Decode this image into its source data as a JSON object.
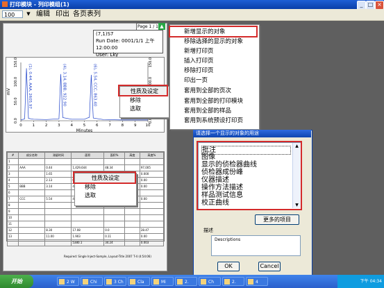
{
  "window": {
    "title": "打印模块 - 列印模组(1)"
  },
  "toolbar": {
    "zoom": "100",
    "menu": [
      "编辑",
      "印出",
      "各页表列"
    ]
  },
  "page": {
    "page_label": "Page 1 / 1",
    "info_lines": [
      "(7,1)S7",
      "Run Date: 0001/1/1 上午 12:00:00",
      "User: Lky"
    ]
  },
  "chart_data": {
    "type": "line",
    "xlabel": "Minutes",
    "ylabel": "mV",
    "x_ticks": [
      "0",
      "1",
      "2",
      "3",
      "4",
      "5",
      "6",
      "7",
      "8",
      "9",
      "10"
    ],
    "y_ticks_left": [
      "150.0",
      "100.0",
      "50.0",
      "0.0"
    ],
    "y_ticks_right": [
      "150.0",
      "100.0",
      "50.0",
      "0.0"
    ],
    "xlim": [
      0,
      10
    ],
    "ylim": [
      0,
      150
    ],
    "peak_labels": [
      "(1), 0.44, AAA, 2605.97",
      "(4), 3.14, BBB, 922.90",
      "(6), 5.54, CCC, 863.40"
    ],
    "peaks_x": [
      0.44,
      3.14,
      5.54
    ],
    "series": [
      {
        "x": [
          0,
          0.3,
          0.44,
          0.6,
          1.0,
          2.0,
          3.0,
          3.14,
          3.3,
          4.0,
          5.0,
          5.4,
          5.54,
          5.7,
          6.5,
          8.0,
          10.0
        ],
        "y": [
          2,
          5,
          135,
          6,
          4,
          3,
          5,
          120,
          8,
          4,
          4,
          9,
          118,
          7,
          3,
          2,
          2
        ]
      }
    ]
  },
  "context_menu_chart": {
    "header": "性质及设定",
    "items": [
      "移除",
      "选取"
    ]
  },
  "context_menu_table": {
    "header": "性质及设定",
    "items": [
      "移除",
      "选取"
    ]
  },
  "results_table": {
    "headers": [
      "#",
      "成分名称",
      "滞留时间",
      "面积",
      "面积%",
      "高度",
      "高度%"
    ],
    "rows": [
      [
        "1",
        "",
        "",
        "",
        "",
        "",
        ""
      ],
      [
        "2",
        "AAA",
        "0.44",
        "1,429,644",
        "48.34",
        "",
        "97,005"
      ],
      [
        "3",
        "",
        "1.65",
        "10.4",
        "3.71",
        "",
        "0.000"
      ],
      [
        "4",
        "",
        "2.13",
        "0.0",
        "0.38",
        "",
        "0.00"
      ],
      [
        "5",
        "BBB",
        "3.14",
        "47,8",
        "20.0",
        "",
        "0.00"
      ],
      [
        "6",
        "",
        "",
        "",
        "",
        "",
        ""
      ],
      [
        "7",
        "CCC",
        "5.54",
        "47,003",
        "28.0",
        "",
        "0.00"
      ],
      [
        "8",
        "",
        "",
        "",
        "",
        "",
        ""
      ],
      [
        "9",
        "",
        "",
        "",
        "",
        "",
        ""
      ],
      [
        "10",
        "",
        "",
        "",
        "",
        "",
        ""
      ],
      [
        "11",
        "",
        "",
        "",
        "",
        "",
        ""
      ],
      [
        "12",
        "",
        "8.30",
        "17.08",
        "0.0",
        "",
        "28.47"
      ],
      [
        "13",
        "",
        "11.00",
        "1.903",
        "0.11",
        "",
        "0.00"
      ],
      [
        "",
        "",
        "",
        "5380.1",
        "34.24",
        "",
        "0.003"
      ]
    ],
    "footer": "Required: Single Inject-Sample, Layout-Title 2007 T-4 (4:54:06)"
  },
  "main_context_menu": {
    "items": [
      "新增显示的对象",
      "移除选择的显示的对象",
      "新增打印页",
      "插入打印页",
      "移除打印页",
      "印出一页",
      "套用到全部的页次",
      "套用到全部的打印模块",
      "套用到全部的样品",
      "套用到系统预设打印页"
    ]
  },
  "dialog": {
    "title": "请选择一个显示的对象的用途",
    "list_items": [
      "批注",
      "图像",
      "显示的侦检器曲线",
      "侦检器成份峰",
      "仪器描述",
      "操作方法描述",
      "样品测试信息",
      "校正曲线"
    ],
    "more_button": "更多的项目",
    "description_label": "描述",
    "description_value": "Descriptions",
    "ok_button": "OK",
    "cancel_button": "Cancel"
  },
  "taskbar": {
    "start_label": "开始",
    "items": [
      "2 W",
      "Chi",
      "3 Ch",
      "Cla",
      "Mi",
      "2.",
      "Ch",
      "2.",
      "4"
    ],
    "clock": "下午 04:34"
  }
}
